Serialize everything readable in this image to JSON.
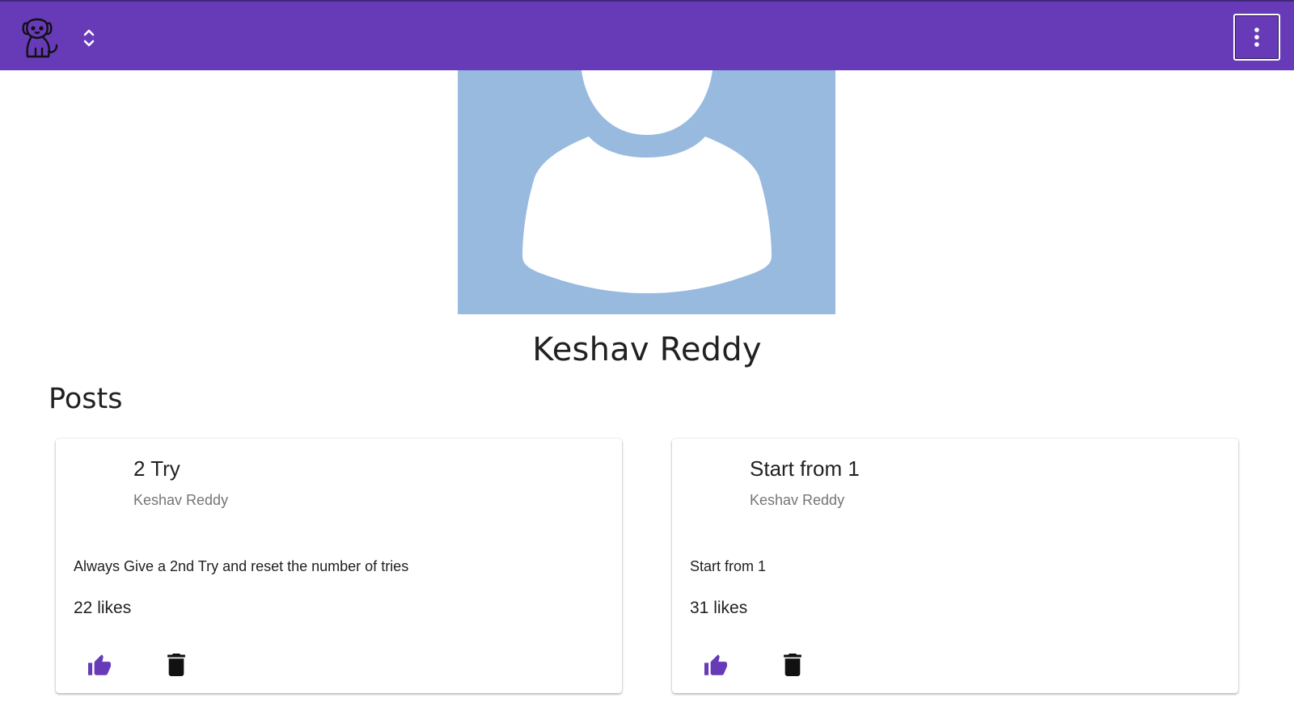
{
  "appbar": {
    "logo_icon": "dog-icon",
    "sort_icon": "unfold-more-icon",
    "menu_icon": "more-vert-icon",
    "color": "#673ab7"
  },
  "profile": {
    "avatar_icon": "default-person-avatar",
    "name": "Keshav Reddy"
  },
  "posts": {
    "heading": "Posts",
    "items": [
      {
        "title": "2 Try",
        "author": "Keshav Reddy",
        "body": "Always Give a 2nd Try and reset the number of tries",
        "likes": "22 likes",
        "like_icon": "thumb-up-icon",
        "delete_icon": "trash-icon"
      },
      {
        "title": "Start from 1",
        "author": "Keshav Reddy",
        "body": "Start from 1",
        "likes": "31 likes",
        "like_icon": "thumb-up-icon",
        "delete_icon": "trash-icon"
      }
    ]
  },
  "colors": {
    "accent": "#673ab7",
    "avatar_bg": "#98badf",
    "muted_text": "#757575"
  }
}
